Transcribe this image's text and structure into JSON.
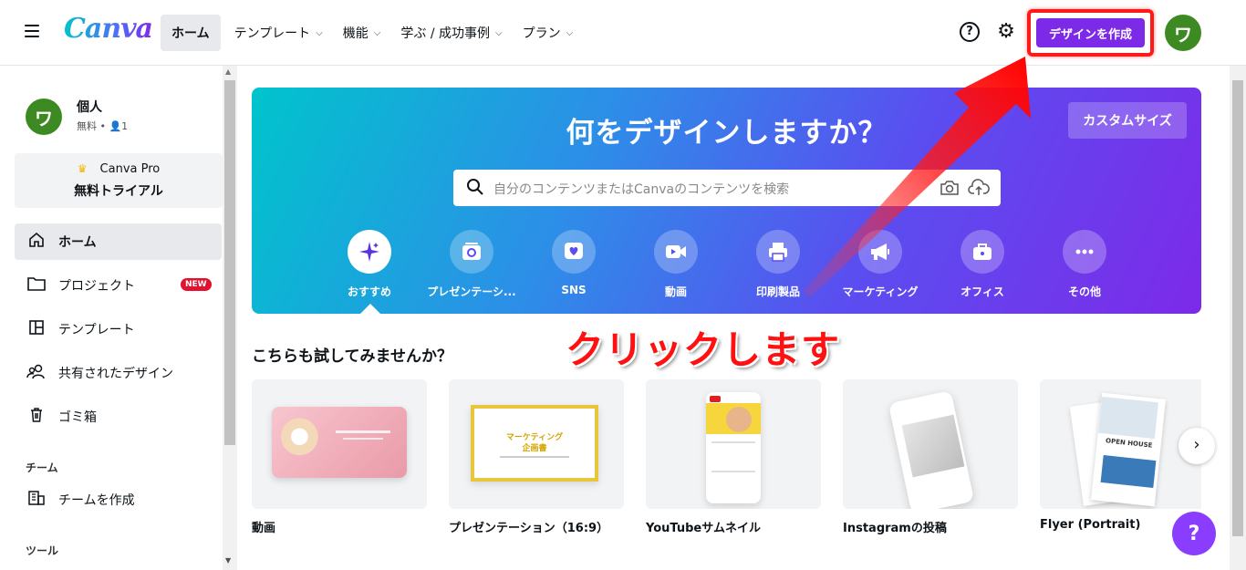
{
  "header": {
    "logo": "Canva",
    "nav": [
      {
        "label": "ホーム",
        "active": true
      },
      {
        "label": "テンプレート",
        "chevron": true
      },
      {
        "label": "機能",
        "chevron": true
      },
      {
        "label": "学ぶ / 成功事例",
        "chevron": true
      },
      {
        "label": "プラン",
        "chevron": true
      }
    ],
    "help_icon": "?",
    "create_button": "デザインを作成",
    "avatar_initial": "ワ"
  },
  "sidebar": {
    "user": {
      "initial": "ワ",
      "name": "個人",
      "meta": "無料 • 👤1"
    },
    "pro": {
      "line1": "Canva Pro",
      "line2": "無料トライアル"
    },
    "items": [
      {
        "label": "ホーム",
        "icon": "home-icon",
        "active": true
      },
      {
        "label": "プロジェクト",
        "icon": "folder-icon",
        "badge": "NEW"
      },
      {
        "label": "テンプレート",
        "icon": "template-icon"
      },
      {
        "label": "共有されたデザイン",
        "icon": "shared-icon"
      },
      {
        "label": "ゴミ箱",
        "icon": "trash-icon"
      }
    ],
    "team_section": "チーム",
    "team_item": {
      "label": "チームを作成",
      "icon": "building-icon"
    },
    "tools_section": "ツール"
  },
  "banner": {
    "title": "何をデザインしますか？",
    "custom_size": "カスタムサイズ",
    "search_placeholder": "自分のコンテンツまたはCanvaのコンテンツを検索",
    "categories": [
      {
        "label": "おすすめ",
        "icon": "sparkles-icon",
        "active": true
      },
      {
        "label": "プレゼンテーシ...",
        "icon": "presentation-icon"
      },
      {
        "label": "SNS",
        "icon": "heart-icon"
      },
      {
        "label": "動画",
        "icon": "video-icon"
      },
      {
        "label": "印刷製品",
        "icon": "printer-icon"
      },
      {
        "label": "マーケティング",
        "icon": "megaphone-icon"
      },
      {
        "label": "オフィス",
        "icon": "briefcase-icon"
      },
      {
        "label": "その他",
        "icon": "more-icon"
      }
    ],
    "colors": {
      "start": "#00c4cc",
      "end": "#7d2ae8"
    }
  },
  "suggestions": {
    "title": "こちらも試してみませんか？",
    "cards": [
      {
        "label": "動画"
      },
      {
        "label": "プレゼンテーション（16:9）"
      },
      {
        "label": "YouTubeサムネイル"
      },
      {
        "label": "Instagramの投稿"
      },
      {
        "label": "Flyer (Portrait)"
      }
    ],
    "presentation_mock": {
      "line1": "マーケティング",
      "line2": "企画書"
    },
    "flyer_mock": "OPEN HOUSE"
  },
  "annotation": {
    "text": "クリックします",
    "color": "#ff1111"
  },
  "help_fab": "?"
}
